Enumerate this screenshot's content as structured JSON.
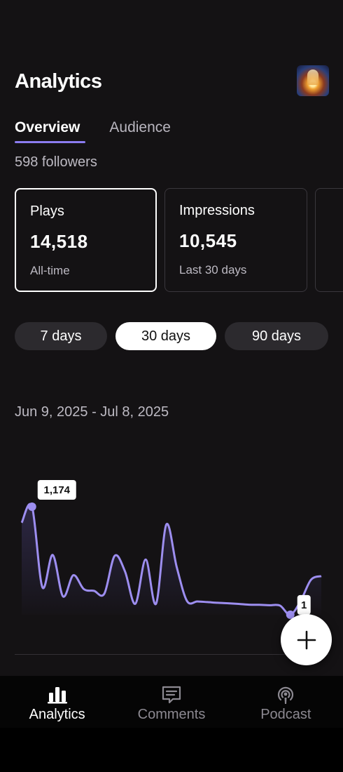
{
  "header": {
    "title": "Analytics",
    "cover_icon": "podcast-cover-art"
  },
  "tabs": [
    {
      "label": "Overview",
      "active": true
    },
    {
      "label": "Audience",
      "active": false
    }
  ],
  "followers_text": "598 followers",
  "stat_cards": [
    {
      "label": "Plays",
      "value": "14,518",
      "sub": "All-time",
      "selected": true
    },
    {
      "label": "Impressions",
      "value": "10,545",
      "sub": "Last 30 days",
      "selected": false
    }
  ],
  "ranges": [
    {
      "label": "7 days",
      "active": false
    },
    {
      "label": "30 days",
      "active": true
    },
    {
      "label": "90 days",
      "active": false
    }
  ],
  "date_range": "Jun 9, 2025 - Jul 8, 2025",
  "chart_data": {
    "type": "area",
    "series_color": "#9d8ef0",
    "peak_label": "1,174",
    "min_label": "1",
    "peak_index": 1,
    "min_index": 26,
    "values": [
      1000,
      1174,
      300,
      650,
      200,
      430,
      280,
      260,
      230,
      640,
      470,
      120,
      600,
      120,
      980,
      520,
      150,
      145,
      138,
      130,
      125,
      118,
      110,
      108,
      104,
      100,
      1,
      150,
      380,
      420
    ]
  },
  "fab": {
    "icon": "plus-icon"
  },
  "bottom_nav": [
    {
      "label": "Analytics",
      "icon": "bar-chart-icon",
      "active": true
    },
    {
      "label": "Comments",
      "icon": "comment-icon",
      "active": false
    },
    {
      "label": "Podcast",
      "icon": "podcast-icon",
      "active": false
    }
  ]
}
